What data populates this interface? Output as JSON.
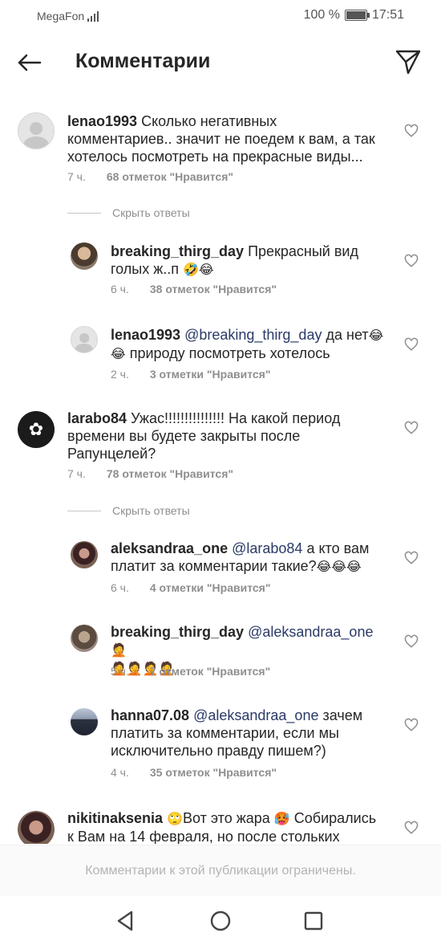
{
  "status_bar": {
    "carrier": "MegaFon",
    "battery_percent": "100 %",
    "battery_level": 1.0,
    "time": "17:51"
  },
  "header": {
    "back_icon": "arrow-left-icon",
    "title": "Комментарии",
    "send_icon": "paper-plane-icon"
  },
  "comments": [
    {
      "username": "lenao1993",
      "avatar": "default-avatar",
      "line1": "Сколько негативных",
      "line2": "комментариев.. значит не поедем к вам, а так",
      "line3": "хотелось посмотреть на прекрасные виды...",
      "time": "7 ч.",
      "likes": "68 отметок \"Нравится\"",
      "hide_replies": "Скрыть ответы",
      "replies": [
        {
          "username": "breaking_thirg_day",
          "line1": "Прекрасный вид",
          "line2": "голых ж..п",
          "line2_emoji": "🤣😂",
          "time": "6 ч.",
          "likes": "38 отметок \"Нравится\""
        },
        {
          "username": "lenao1993",
          "mention": "@breaking_thirg_day",
          "line1": "да нет",
          "line1_emoji": "😂",
          "line2_emoji": "😂",
          "line2": "природу посмотреть хотелось",
          "time": "2 ч.",
          "likes": "3 отметки \"Нравится\""
        }
      ]
    },
    {
      "username": "larabo84",
      "avatar": "flower-avatar",
      "line1": "Ужас!!!!!!!!!!!!!!! На какой период",
      "line2": "времени вы будете закрыты после",
      "line3": "Рапунцелей?",
      "time": "7 ч.",
      "likes": "78 отметок \"Нравится\"",
      "hide_replies": "Скрыть ответы",
      "replies": [
        {
          "username": "aleksandraa_one",
          "mention": "@larabo84",
          "line1": "а кто вам",
          "line2": "платит за комментарии такие?",
          "line2_emoji": "😂😂😂",
          "time": "6 ч.",
          "likes": "4 отметки \"Нравится\""
        },
        {
          "username": "breaking_thirg_day",
          "mention": "@aleksandraa_one",
          "line1_emoji": "🤦",
          "line2_emoji": "🤦🤦🤦🤦",
          "time": "5 ч.",
          "likes": "7 отметок \"Нравится\""
        },
        {
          "username": "hanna07.08",
          "mention": "@aleksandraa_one",
          "line1": "зачем",
          "line2": "платить за комментарии, если мы",
          "line3": "исключительно правду пишем?)",
          "time": "4 ч.",
          "likes": "35 отметок \"Нравится\""
        }
      ]
    },
    {
      "username": "nikitinaksenia",
      "emoji1": "🙄",
      "line1": "Вот это жара",
      "emoji2": "🥵",
      "line1b": "Собирались",
      "line2": "к Вам на 14 февраля, но после стольких"
    }
  ],
  "footer": {
    "notice": "Комментарии к этой публикации ограничены."
  },
  "navbar": {
    "back_icon": "triangle-back-icon",
    "home_icon": "circle-home-icon",
    "recents_icon": "square-recents-icon"
  },
  "colors": {
    "text": "#262626",
    "secondary": "#8e8e8e",
    "mention": "#2b3a67",
    "footer_text": "#b4b4b4"
  }
}
